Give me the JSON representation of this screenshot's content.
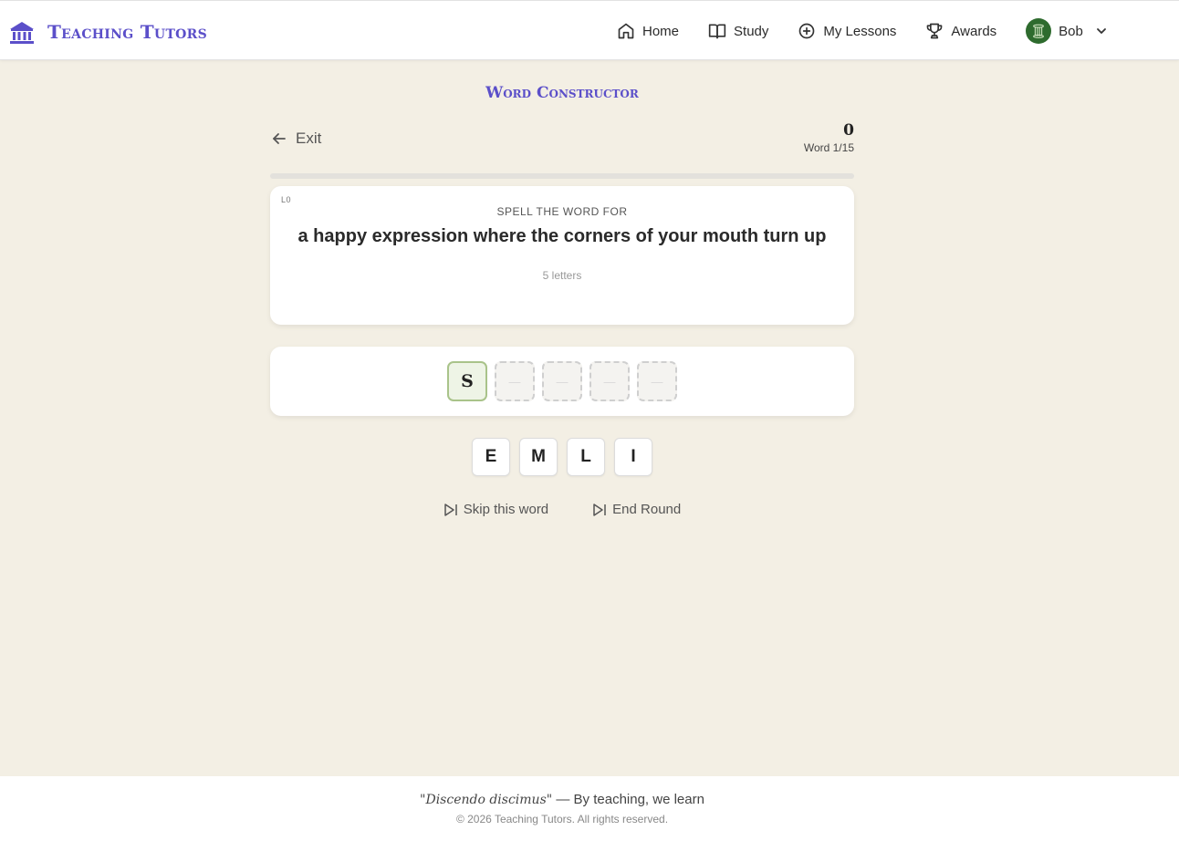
{
  "header": {
    "brand": "Teaching Tutors",
    "nav": [
      {
        "label": "Home",
        "icon": "home-icon"
      },
      {
        "label": "Study",
        "icon": "book-icon"
      },
      {
        "label": "My Lessons",
        "icon": "plus-circle-icon"
      },
      {
        "label": "Awards",
        "icon": "trophy-icon"
      }
    ],
    "user": {
      "name": "Bob",
      "avatar_color": "#2e6b2e"
    }
  },
  "page": {
    "title": "Word Constructor"
  },
  "game": {
    "exit_label": "Exit",
    "score": "0",
    "word_count": "Word 1/15",
    "progress": 0,
    "level_tag": "L0",
    "prompt": "SPELL THE WORD FOR",
    "clue": "a happy expression where the corners of your mouth turn up",
    "letter_count": "5 letters",
    "slots": [
      "S",
      "",
      "",
      "",
      ""
    ],
    "slot_placeholder": "—",
    "tiles": [
      "E",
      "M",
      "L",
      "I"
    ],
    "skip_label": "Skip this word",
    "end_label": "End Round"
  },
  "footer": {
    "motto_latin": "\"Discendo discimus\"",
    "motto_rest": " — By teaching, we learn",
    "copyright": "© 2026 Teaching Tutors. All rights reserved."
  },
  "colors": {
    "accent": "#5b4fc9",
    "background": "#f3efe4",
    "filled_slot_border": "#a9c38a"
  }
}
